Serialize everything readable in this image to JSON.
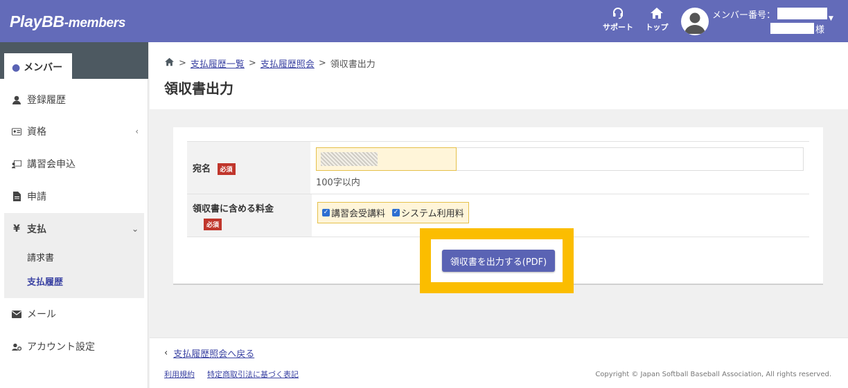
{
  "header": {
    "logo_main": "PlayBB",
    "logo_sub": "-members",
    "support_label": "サポート",
    "top_label": "トップ",
    "member_label": "メンバー番号：",
    "honorific": "様"
  },
  "sidebar": {
    "member_tab": "メンバー",
    "items": [
      {
        "label": "登録履歴"
      },
      {
        "label": "資格"
      },
      {
        "label": "講習会申込"
      },
      {
        "label": "申請"
      },
      {
        "label": "支払"
      },
      {
        "label": "メール"
      },
      {
        "label": "アカウント設定"
      }
    ],
    "pay_sub": [
      "請求書",
      "支払履歴"
    ]
  },
  "breadcrumb": {
    "items": [
      "支払履歴一覧",
      "支払履歴照会"
    ],
    "current": "領収書出力"
  },
  "page_title": "領収書出力",
  "form": {
    "name_label": "宛名",
    "required": "必須",
    "name_hint": "100字以内",
    "fees_label": "領収書に含める料金",
    "fee_options": [
      {
        "label": "講習会受講料",
        "checked": true
      },
      {
        "label": "システム利用料",
        "checked": true
      }
    ],
    "submit": "領収書を出力する(PDF)"
  },
  "footer": {
    "back": "支払履歴照会へ戻る",
    "links": [
      "利用規約",
      "特定商取引法に基づく表記"
    ],
    "copyright": "Copyright © Japan Softball Baseball Association, All rights reserved."
  },
  "colors": {
    "header": "#636bb9",
    "accent": "#3b43a3",
    "highlight": "#fbbd00",
    "required": "#c0362c"
  }
}
